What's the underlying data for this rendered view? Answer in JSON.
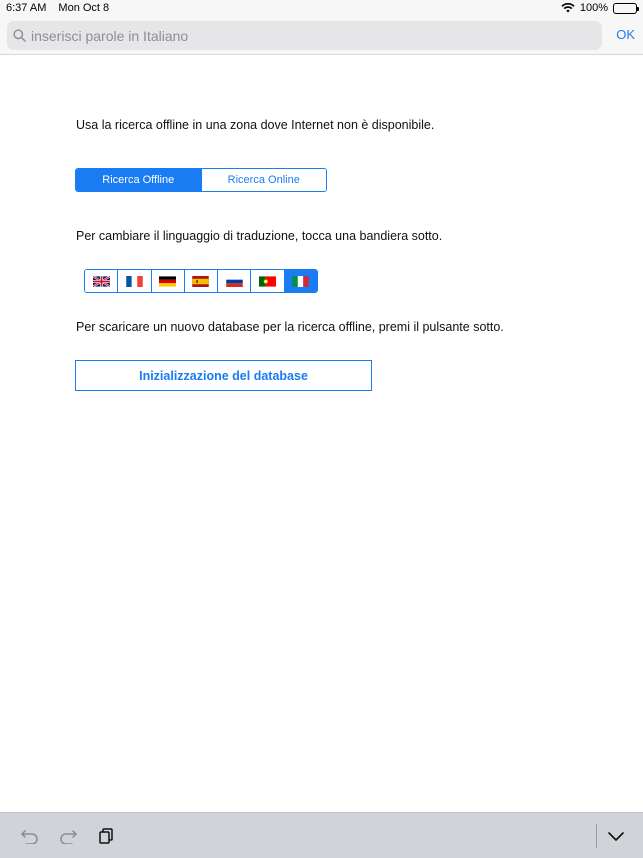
{
  "status_bar": {
    "time": "6:37 AM",
    "date": "Mon Oct 8",
    "battery": "100%"
  },
  "search": {
    "placeholder": "inserisci parole in Italiano",
    "ok_label": "OK"
  },
  "content": {
    "offline_hint": "Usa la ricerca offline in una zona dove Internet non è disponibile.",
    "segment": {
      "offline_label": "Ricerca Offline",
      "online_label": "Ricerca Online",
      "selected": "offline"
    },
    "language_hint": "Per cambiare il linguaggio di traduzione, tocca una bandiera sotto.",
    "flags": [
      {
        "icon": "uk-flag-icon",
        "selected": false
      },
      {
        "icon": "france-flag-icon",
        "selected": false
      },
      {
        "icon": "germany-flag-icon",
        "selected": false
      },
      {
        "icon": "spain-flag-icon",
        "selected": false
      },
      {
        "icon": "russia-flag-icon",
        "selected": false
      },
      {
        "icon": "portugal-flag-icon",
        "selected": false
      },
      {
        "icon": "italy-flag-icon",
        "selected": true
      }
    ],
    "database_hint": "Per scaricare un nuovo database per la ricerca offline, premi il pulsante sotto.",
    "init_button_label": "Inizializzazione del database"
  },
  "colors": {
    "accent": "#1a7cf2",
    "toolbar": "#d1d3d9"
  },
  "toolbar": {
    "icons": [
      "undo-icon",
      "redo-icon",
      "paste-icon",
      "hide-keyboard-icon"
    ]
  }
}
